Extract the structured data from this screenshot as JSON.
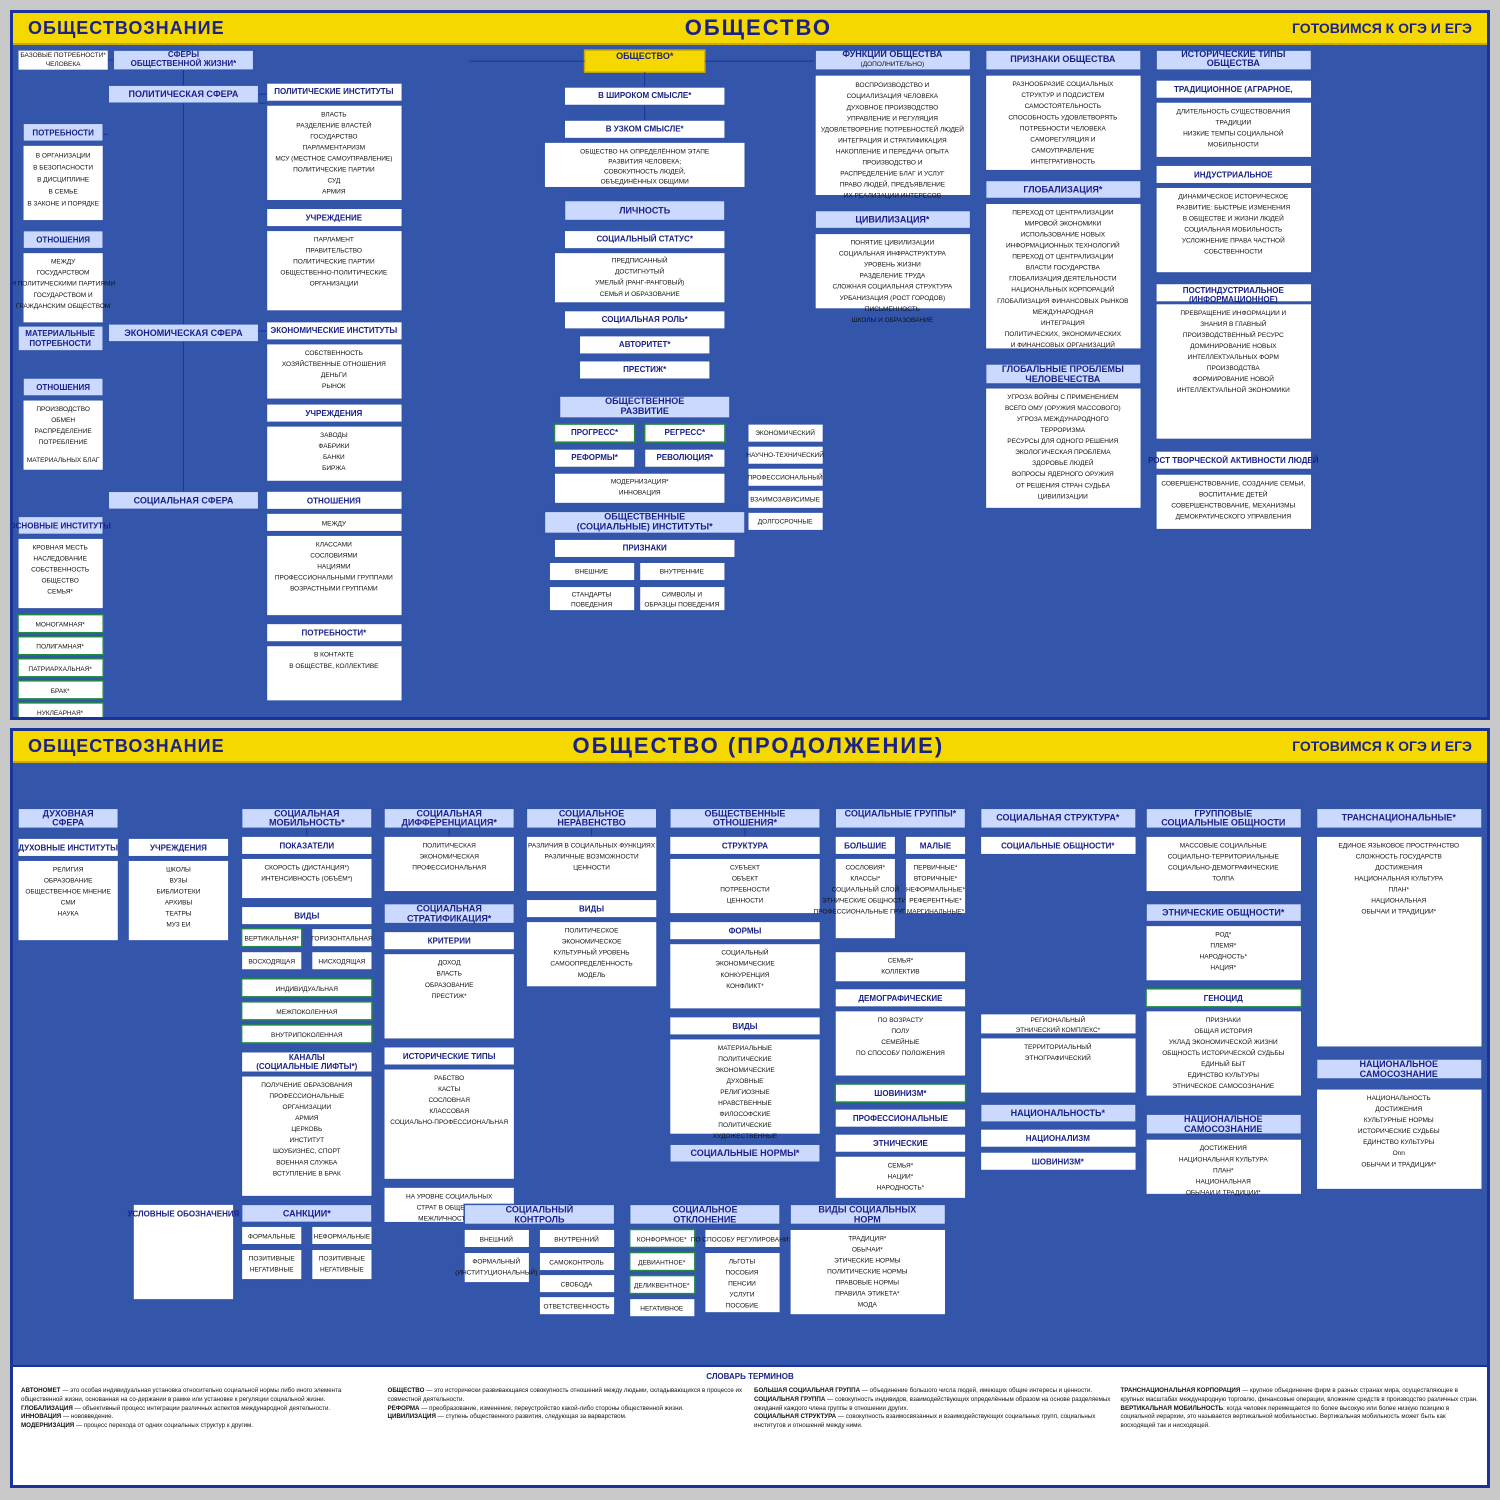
{
  "top_poster": {
    "header_left": "ОБЩЕСТВОЗНАНИЕ",
    "header_center": "ОБЩЕСТВО",
    "header_right": "ГОТОВИМСЯ К ОГЭ И ЕГЭ"
  },
  "bottom_poster": {
    "header_left": "ОБЩЕСТВОЗНАНИЕ",
    "header_center": "ОБЩЕСТВО (продолжение)",
    "header_right": "ГОТОВИМСЯ К ОГЭ И ЕГЭ"
  },
  "glossary_title": "СЛОВАРЬ ТЕРМИНОВ",
  "detected_text": "Onn"
}
